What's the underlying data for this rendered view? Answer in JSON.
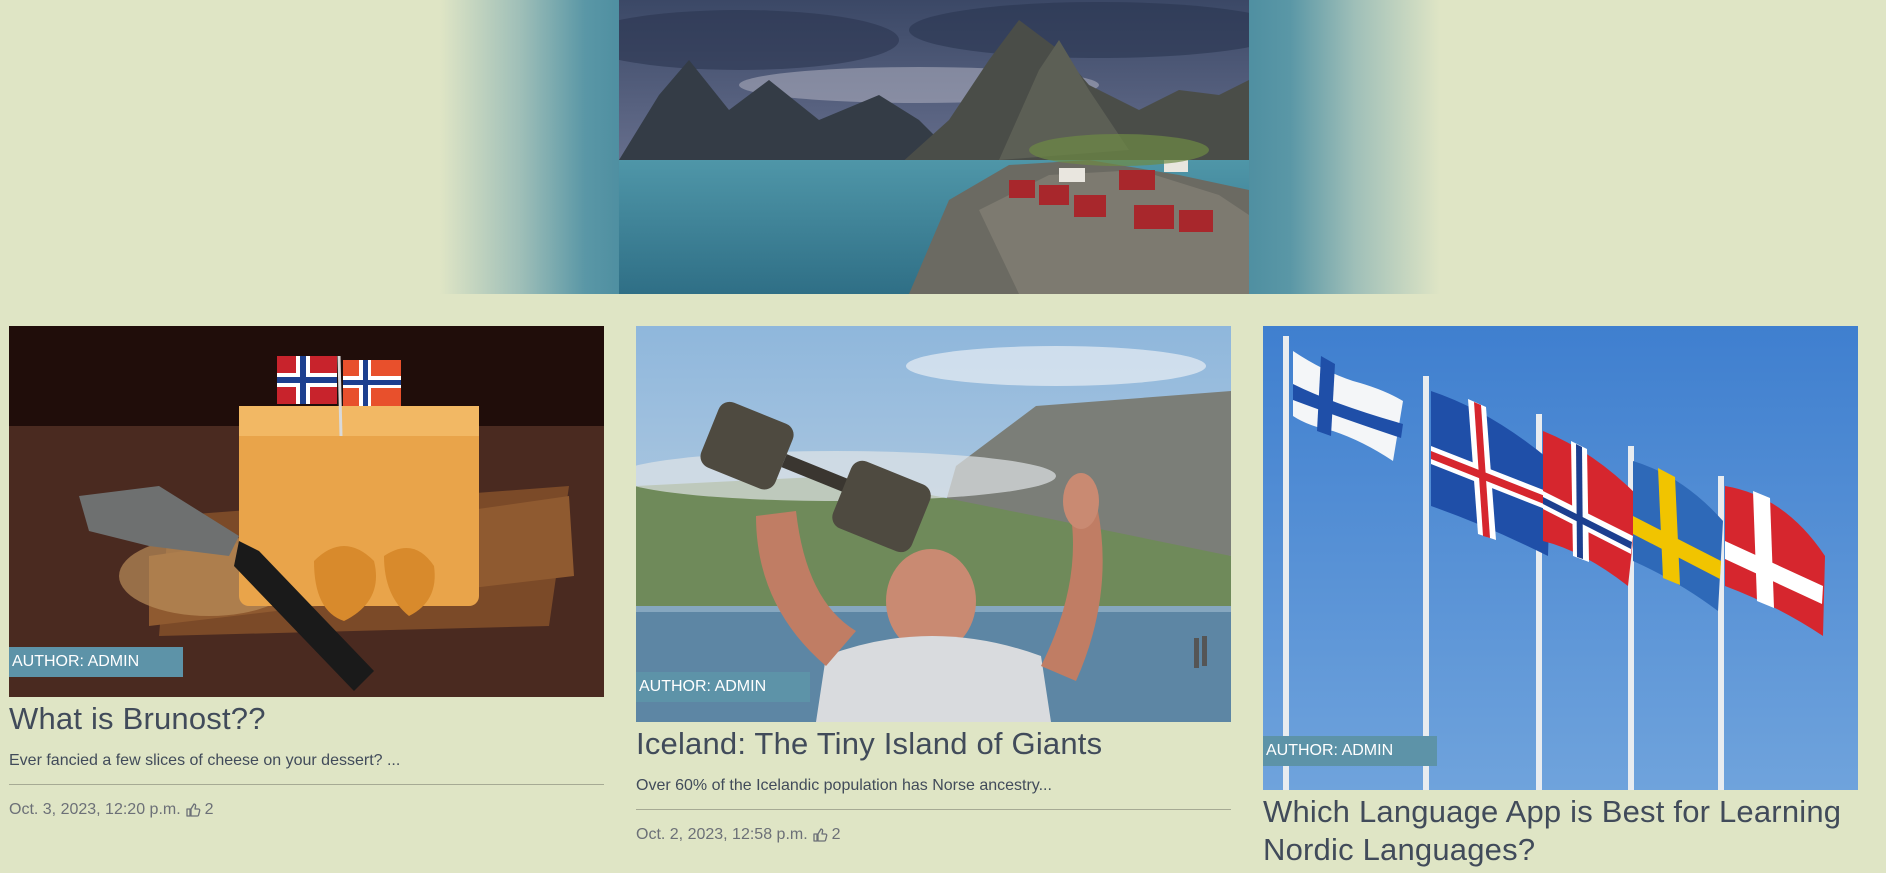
{
  "hero": {
    "image_alt": "Lofoten fjord with red fishing cabins"
  },
  "posts": [
    {
      "author": "AUTHOR: ADMIN",
      "title": "What is Brunost??",
      "excerpt": "Ever fancied a few slices of cheese on your dessert? ...",
      "date": "Oct. 3, 2023, 12:20 p.m.",
      "likes": "2",
      "image_alt": "Brunost brown cheese with Norwegian flags"
    },
    {
      "author": "AUTHOR: ADMIN",
      "title": "Iceland: The Tiny Island of Giants",
      "excerpt": "Over 60% of the Icelandic population has Norse ancestry...",
      "date": "Oct. 2, 2023, 12:58 p.m.",
      "likes": "2",
      "image_alt": "Strongman lifting a giant dumbbell by the sea"
    },
    {
      "author": "AUTHOR: ADMIN",
      "title": "Which Language App is Best for Learning Nordic Languages?",
      "image_alt": "Nordic flags on flagpoles"
    }
  ],
  "colors": {
    "page_bg": "#dfe5c5",
    "badge_bg": "#5d93a8",
    "title_text": "#414b5a"
  },
  "icons": {
    "like": "thumbs-up-icon"
  }
}
